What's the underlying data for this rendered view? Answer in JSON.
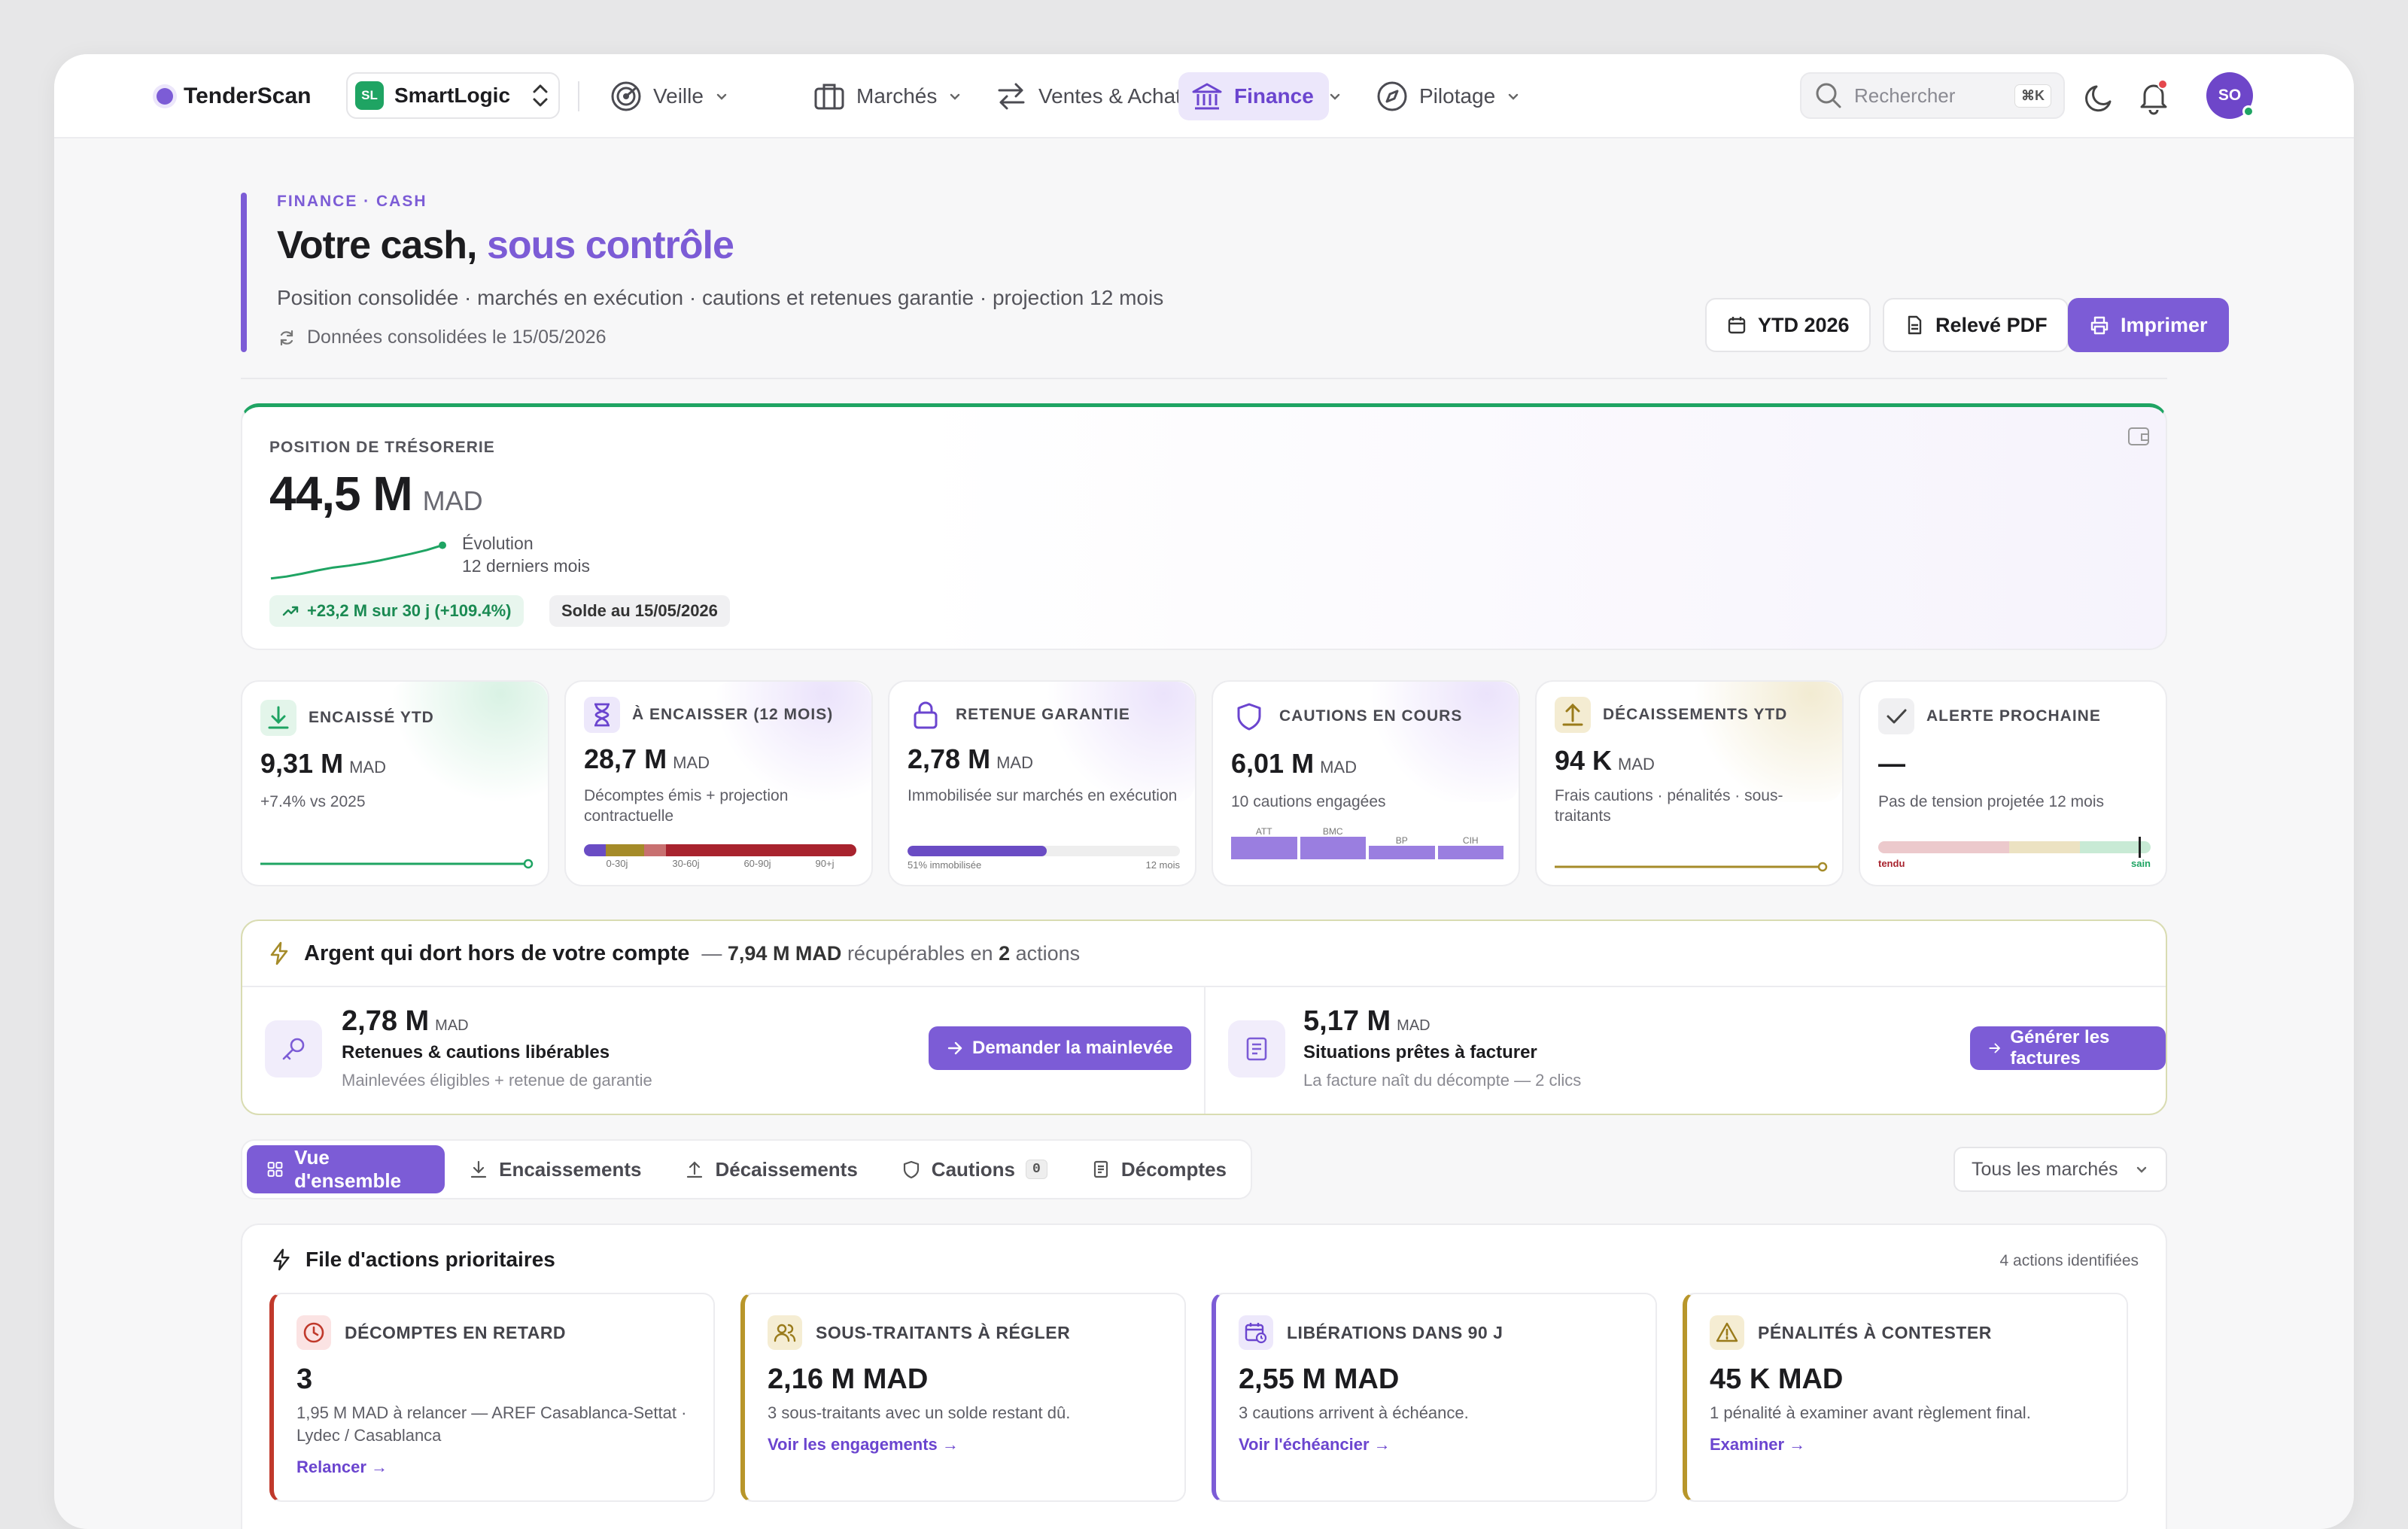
{
  "app": {
    "brand": "TenderScan"
  },
  "workspace": {
    "initials": "SL",
    "name": "SmartLogic"
  },
  "nav": {
    "veille": "Veille",
    "marches": "Marchés",
    "ventes": "Ventes & Achats",
    "finance": "Finance",
    "pilotage": "Pilotage"
  },
  "search": {
    "placeholder": "Rechercher",
    "shortcut": "⌘K"
  },
  "user": {
    "initials": "SO"
  },
  "hero": {
    "eyebrow": "FINANCE · CASH",
    "title_a": "Votre cash,",
    "title_b": "sous contrôle",
    "subtitle": "Position consolidée · marchés en exécution · cautions et retenues garantie · projection 12 mois",
    "updated": "Données consolidées le 15/05/2026",
    "period_btn": "YTD 2026",
    "pdf_btn": "Relevé PDF",
    "print_btn": "Imprimer"
  },
  "treasury": {
    "label": "POSITION DE TRÉSORERIE",
    "value": "44,5 M",
    "unit": "MAD",
    "evo1": "Évolution",
    "evo2": "12 derniers mois",
    "delta": "+23,2 M sur 30 j (+109.4%)",
    "balance": "Solde au 15/05/2026",
    "trend": [
      0.1,
      0.14,
      0.2,
      0.27,
      0.33,
      0.37,
      0.42,
      0.48,
      0.55,
      0.62,
      0.7,
      0.8
    ]
  },
  "kpis": [
    {
      "label": "ENCAISSÉ YTD",
      "value": "9,31 M",
      "unit": "MAD",
      "desc": "+7.4% vs 2025",
      "color": "#1fa463"
    },
    {
      "label": "À ENCAISSER (12 MOIS)",
      "value": "28,7 M",
      "unit": "MAD",
      "desc": "Décomptes émis + projection contractuelle",
      "color": "#7c5cd6",
      "aging": [
        "0-30j",
        "30-60j",
        "60-90j",
        "90+j"
      ]
    },
    {
      "label": "RETENUE GARANTIE",
      "value": "2,78 M",
      "unit": "MAD",
      "desc": "Immobilisée sur marchés en exécution",
      "color": "#7c5cd6",
      "bar_left": "51% immobilisée",
      "bar_right": "12 mois",
      "fill": 0.51
    },
    {
      "label": "CAUTIONS EN COURS",
      "value": "6,01 M",
      "unit": "MAD",
      "desc": "10 cautions engagées",
      "color": "#7c5cd6",
      "banks": [
        "ATT",
        "BMC",
        "BP",
        "CIH"
      ]
    },
    {
      "label": "DÉCAISSEMENTS YTD",
      "value": "94 K",
      "unit": "MAD",
      "desc": "Frais cautions · pénalités · sous-traitants",
      "color": "#b8962a"
    },
    {
      "label": "ALERTE PROCHAINE",
      "value": "—",
      "unit": "",
      "desc": "Pas de tension projetée 12 mois",
      "color": "#555",
      "scale_left": "tendu",
      "scale_right": "sain"
    }
  ],
  "dormant": {
    "title": "Argent qui dort hors de votre compte",
    "summary_pre": "— ",
    "summary_amount": "7,94 M MAD",
    "summary_mid": " récupérables en ",
    "summary_count": "2",
    "summary_post": " actions",
    "items": [
      {
        "value": "2,78 M",
        "unit": "MAD",
        "label": "Retenues & cautions libérables",
        "meta": "Mainlevées éligibles + retenue de garantie",
        "action": "Demander la mainlevée"
      },
      {
        "value": "5,17 M",
        "unit": "MAD",
        "label": "Situations prêtes à facturer",
        "meta": "La facture naît du décompte — 2 clics",
        "action": "Générer les factures"
      }
    ]
  },
  "tabs": {
    "overview": "Vue d'ensemble",
    "encaissements": "Encaissements",
    "decaissements": "Décaissements",
    "cautions": "Cautions",
    "cautions_count": "0",
    "decomptes": "Décomptes"
  },
  "filter": {
    "value": "Tous les marchés"
  },
  "priorities": {
    "title": "File d'actions prioritaires",
    "count": "4 actions identifiées",
    "cards": [
      {
        "title": "DÉCOMPTES EN RETARD",
        "value": "3",
        "desc": "1,95 M MAD à relancer — AREF Casablanca-Settat · Lydec / Casablanca",
        "link": "Relancer →",
        "color": "#c0392b"
      },
      {
        "title": "SOUS-TRAITANTS À RÉGLER",
        "value": "2,16 M MAD",
        "desc": "3 sous-traitants avec un solde restant dû.",
        "link": "Voir les engagements →",
        "color": "#b8962a"
      },
      {
        "title": "LIBÉRATIONS DANS 90 J",
        "value": "2,55 M MAD",
        "desc": "3 cautions arrivent à échéance.",
        "link": "Voir l'échéancier →",
        "color": "#7c5cd6"
      },
      {
        "title": "PÉNALITÉS À CONTESTER",
        "value": "45 K MAD",
        "desc": "1 pénalité à examiner avant règlement final.",
        "link": "Examiner →",
        "color": "#b8962a"
      }
    ]
  }
}
